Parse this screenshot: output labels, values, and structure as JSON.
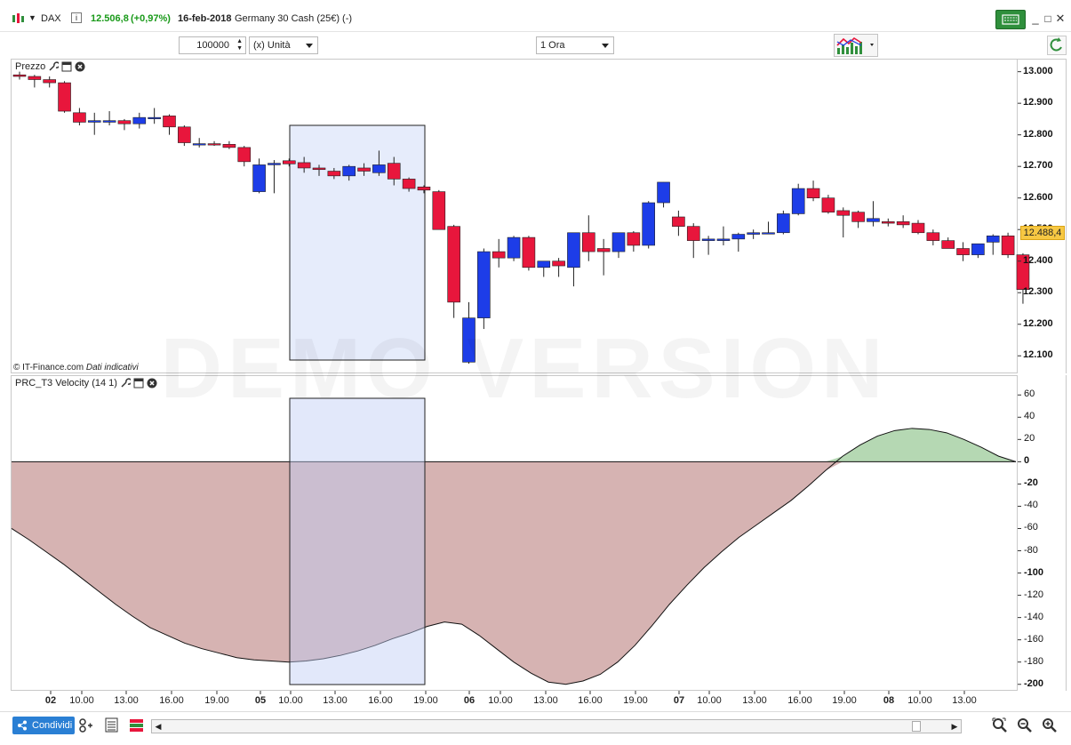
{
  "header": {
    "symbol": "DAX",
    "price": "12.506,8",
    "change": "(+0,97%)",
    "date": "16-feb-2018",
    "instrument": "Germany 30 Cash (25€) (-)"
  },
  "toolbar": {
    "quantity": "100000",
    "unit": "(x) Unità",
    "timeframe": "1 Ora"
  },
  "price_panel": {
    "label": "Prezzo",
    "copyright": "© IT-Finance.com",
    "data_note": "Dati indicativi",
    "current_price": "12.488,4",
    "y_ticks": [
      "13.000",
      "12.900",
      "12.800",
      "12.700",
      "12.600",
      "12.500",
      "12.400",
      "12.300",
      "12.200",
      "12.100"
    ]
  },
  "indicator_panel": {
    "label": "PRC_T3 Velocity (14 1)",
    "y_ticks": [
      "60",
      "40",
      "20",
      "0",
      "-20",
      "-40",
      "-60",
      "-80",
      "-100",
      "-120",
      "-140",
      "-160",
      "-180",
      "-200"
    ]
  },
  "x_axis": [
    "02",
    "10.00",
    "13.00",
    "16.00",
    "19.00",
    "05",
    "10.00",
    "13.00",
    "16.00",
    "19.00",
    "06",
    "10.00",
    "13.00",
    "16.00",
    "19.00",
    "07",
    "10.00",
    "13.00",
    "16.00",
    "19.00",
    "08",
    "10.00",
    "13.00"
  ],
  "watermark": "DEMO VERSION",
  "bottom": {
    "share_label": "Condividi"
  },
  "chart_data": [
    {
      "type": "candlestick",
      "title": "Prezzo",
      "ylim": [
        12050,
        13030
      ],
      "candles": [
        {
          "o": 12990,
          "h": 13000,
          "l": 12975,
          "c": 12985
        },
        {
          "o": 12985,
          "h": 12990,
          "l": 12950,
          "c": 12975
        },
        {
          "o": 12975,
          "h": 12985,
          "l": 12950,
          "c": 12965
        },
        {
          "o": 12965,
          "h": 12970,
          "l": 12870,
          "c": 12875
        },
        {
          "o": 12870,
          "h": 12885,
          "l": 12830,
          "c": 12840
        },
        {
          "o": 12840,
          "h": 12870,
          "l": 12800,
          "c": 12845
        },
        {
          "o": 12840,
          "h": 12875,
          "l": 12830,
          "c": 12845
        },
        {
          "o": 12845,
          "h": 12850,
          "l": 12815,
          "c": 12835
        },
        {
          "o": 12835,
          "h": 12870,
          "l": 12820,
          "c": 12855
        },
        {
          "o": 12855,
          "h": 12885,
          "l": 12835,
          "c": 12855
        },
        {
          "o": 12860,
          "h": 12865,
          "l": 12800,
          "c": 12825
        },
        {
          "o": 12825,
          "h": 12830,
          "l": 12765,
          "c": 12775
        },
        {
          "o": 12772,
          "h": 12790,
          "l": 12760,
          "c": 12772
        },
        {
          "o": 12772,
          "h": 12780,
          "l": 12765,
          "c": 12770
        },
        {
          "o": 12770,
          "h": 12780,
          "l": 12755,
          "c": 12760
        },
        {
          "o": 12760,
          "h": 12765,
          "l": 12700,
          "c": 12715
        },
        {
          "o": 12620,
          "h": 12725,
          "l": 12615,
          "c": 12705
        },
        {
          "o": 12705,
          "h": 12720,
          "l": 12615,
          "c": 12710
        },
        {
          "o": 12718,
          "h": 12725,
          "l": 12700,
          "c": 12708
        },
        {
          "o": 12712,
          "h": 12730,
          "l": 12680,
          "c": 12695
        },
        {
          "o": 12695,
          "h": 12705,
          "l": 12670,
          "c": 12690
        },
        {
          "o": 12685,
          "h": 12695,
          "l": 12660,
          "c": 12670
        },
        {
          "o": 12670,
          "h": 12705,
          "l": 12655,
          "c": 12700
        },
        {
          "o": 12695,
          "h": 12710,
          "l": 12670,
          "c": 12685
        },
        {
          "o": 12680,
          "h": 12750,
          "l": 12670,
          "c": 12705
        },
        {
          "o": 12710,
          "h": 12730,
          "l": 12640,
          "c": 12660
        },
        {
          "o": 12660,
          "h": 12665,
          "l": 12620,
          "c": 12630
        },
        {
          "o": 12635,
          "h": 12640,
          "l": 12615,
          "c": 12625
        },
        {
          "o": 12620,
          "h": 12625,
          "l": 12500,
          "c": 12500
        },
        {
          "o": 12510,
          "h": 12515,
          "l": 12220,
          "c": 12270
        },
        {
          "o": 12080,
          "h": 12270,
          "l": 12075,
          "c": 12220
        },
        {
          "o": 12220,
          "h": 12440,
          "l": 12185,
          "c": 12430
        },
        {
          "o": 12430,
          "h": 12470,
          "l": 12380,
          "c": 12410
        },
        {
          "o": 12410,
          "h": 12480,
          "l": 12400,
          "c": 12475
        },
        {
          "o": 12475,
          "h": 12480,
          "l": 12370,
          "c": 12380
        },
        {
          "o": 12380,
          "h": 12400,
          "l": 12350,
          "c": 12400
        },
        {
          "o": 12400,
          "h": 12410,
          "l": 12350,
          "c": 12385
        },
        {
          "o": 12380,
          "h": 12465,
          "l": 12320,
          "c": 12490
        },
        {
          "o": 12490,
          "h": 12545,
          "l": 12400,
          "c": 12430
        },
        {
          "o": 12440,
          "h": 12470,
          "l": 12355,
          "c": 12430
        },
        {
          "o": 12430,
          "h": 12490,
          "l": 12410,
          "c": 12490
        },
        {
          "o": 12490,
          "h": 12495,
          "l": 12430,
          "c": 12450
        },
        {
          "o": 12450,
          "h": 12590,
          "l": 12440,
          "c": 12585
        },
        {
          "o": 12585,
          "h": 12650,
          "l": 12570,
          "c": 12650
        },
        {
          "o": 12540,
          "h": 12560,
          "l": 12480,
          "c": 12510
        },
        {
          "o": 12510,
          "h": 12520,
          "l": 12410,
          "c": 12465
        },
        {
          "o": 12465,
          "h": 12480,
          "l": 12420,
          "c": 12470
        },
        {
          "o": 12465,
          "h": 12510,
          "l": 12450,
          "c": 12470
        },
        {
          "o": 12470,
          "h": 12490,
          "l": 12430,
          "c": 12485
        },
        {
          "o": 12485,
          "h": 12500,
          "l": 12470,
          "c": 12490
        },
        {
          "o": 12490,
          "h": 12525,
          "l": 12490,
          "c": 12490
        },
        {
          "o": 12490,
          "h": 12560,
          "l": 12485,
          "c": 12550
        },
        {
          "o": 12550,
          "h": 12645,
          "l": 12545,
          "c": 12630
        },
        {
          "o": 12630,
          "h": 12655,
          "l": 12590,
          "c": 12600
        },
        {
          "o": 12600,
          "h": 12610,
          "l": 12550,
          "c": 12555
        },
        {
          "o": 12560,
          "h": 12570,
          "l": 12475,
          "c": 12545
        },
        {
          "o": 12555,
          "h": 12560,
          "l": 12505,
          "c": 12525
        },
        {
          "o": 12525,
          "h": 12590,
          "l": 12510,
          "c": 12535
        },
        {
          "o": 12525,
          "h": 12535,
          "l": 12510,
          "c": 12520
        },
        {
          "o": 12525,
          "h": 12545,
          "l": 12505,
          "c": 12515
        },
        {
          "o": 12520,
          "h": 12530,
          "l": 12485,
          "c": 12490
        },
        {
          "o": 12490,
          "h": 12500,
          "l": 12450,
          "c": 12465
        },
        {
          "o": 12465,
          "h": 12475,
          "l": 12440,
          "c": 12440
        },
        {
          "o": 12440,
          "h": 12460,
          "l": 12400,
          "c": 12420
        },
        {
          "o": 12420,
          "h": 12450,
          "l": 12410,
          "c": 12455
        },
        {
          "o": 12460,
          "h": 12485,
          "l": 12420,
          "c": 12480
        },
        {
          "o": 12480,
          "h": 12490,
          "l": 12410,
          "c": 12420
        },
        {
          "o": 12420,
          "h": 12425,
          "l": 12265,
          "c": 12310
        }
      ]
    },
    {
      "type": "area",
      "title": "PRC_T3 Velocity (14 1)",
      "ylim": [
        -205,
        65
      ],
      "values": [
        -60,
        -70,
        -81,
        -92,
        -104,
        -116,
        -128,
        -139,
        -149,
        -156,
        -163,
        -168,
        -172,
        -176,
        -178,
        -179,
        -180,
        -179,
        -177,
        -174,
        -170,
        -165,
        -159,
        -154,
        -148,
        -144,
        -146,
        -156,
        -168,
        -180,
        -190,
        -198,
        -200,
        -197,
        -191,
        -180,
        -165,
        -147,
        -128,
        -111,
        -95,
        -81,
        -68,
        -57,
        -46,
        -35,
        -22,
        -8,
        5,
        15,
        23,
        28,
        30,
        29,
        26,
        20,
        13,
        5,
        0
      ],
      "colors": {
        "negative": "#d6b3b2",
        "positive": "#b5d8b3"
      }
    }
  ],
  "colors": {
    "bull": "#1d3de8",
    "bear": "#e8163c",
    "highlight": "#e6ecfb",
    "price_tag": "#f7c843"
  }
}
